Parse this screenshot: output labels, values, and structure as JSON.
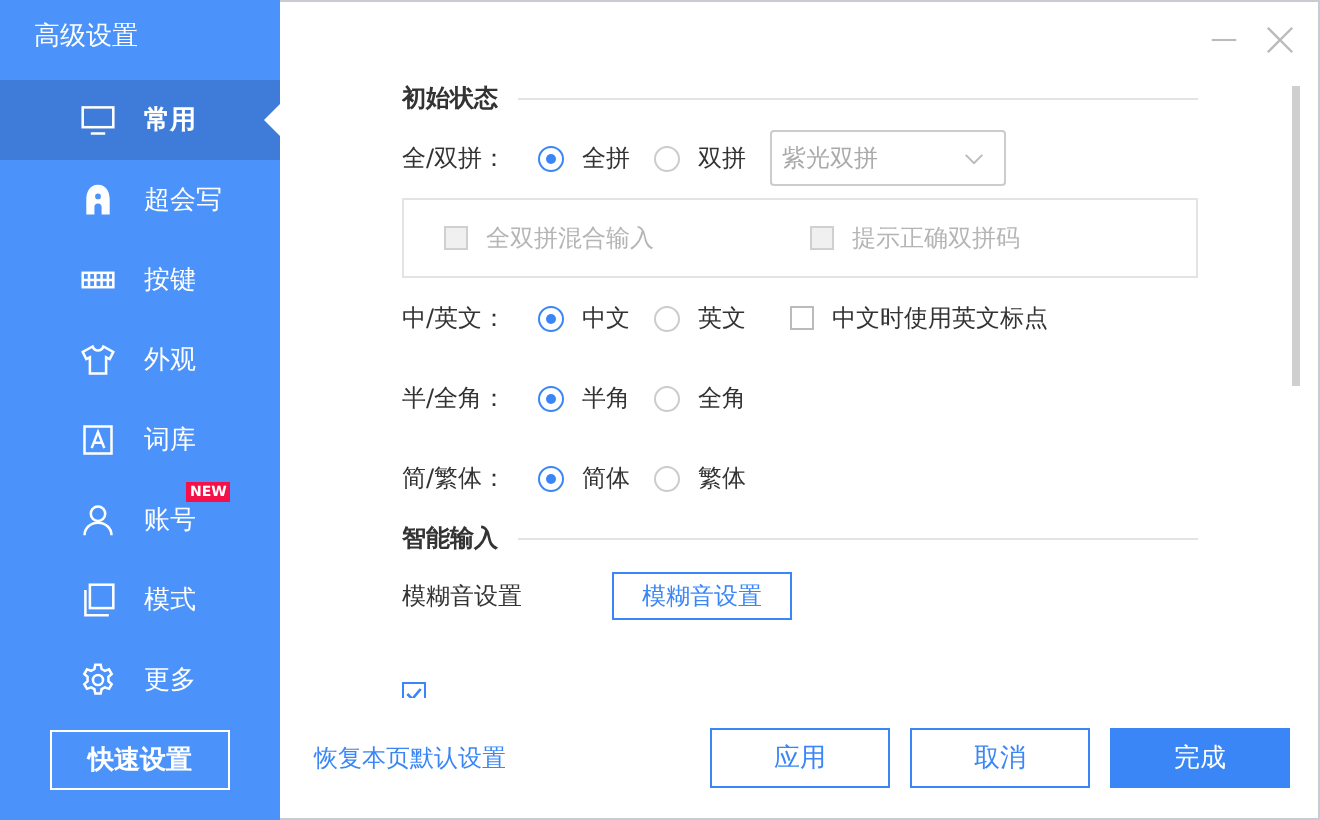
{
  "window": {
    "title": "高级设置"
  },
  "sidebar": {
    "items": [
      {
        "label": "常用",
        "selected": true
      },
      {
        "label": "超会写",
        "selected": false
      },
      {
        "label": "按键",
        "selected": false
      },
      {
        "label": "外观",
        "selected": false
      },
      {
        "label": "词库",
        "selected": false
      },
      {
        "label": "账号",
        "selected": false,
        "badge": "NEW"
      },
      {
        "label": "模式",
        "selected": false
      },
      {
        "label": "更多",
        "selected": false
      }
    ],
    "button": "快速设置"
  },
  "sections": [
    {
      "title": "初始状态",
      "rows": [
        {
          "kind": "radio",
          "label": "全/双拼：",
          "options": [
            {
              "label": "全拼",
              "selected": true
            },
            {
              "label": "双拼",
              "selected": false
            }
          ],
          "dropdown": {
            "value": "紫光双拼",
            "disabled": true
          }
        },
        {
          "kind": "group",
          "disabled": true,
          "items": [
            {
              "label": "全双拼混合输入",
              "checked": false
            },
            {
              "label": "提示正确双拼码",
              "checked": false
            }
          ]
        },
        {
          "kind": "radio",
          "label": "中/英文：",
          "options": [
            {
              "label": "中文",
              "selected": true
            },
            {
              "label": "英文",
              "selected": false
            }
          ],
          "checkbox": {
            "label": "中文时使用英文标点",
            "checked": false
          }
        },
        {
          "kind": "radio",
          "label": "半/全角：",
          "options": [
            {
              "label": "半角",
              "selected": true
            },
            {
              "label": "全角",
              "selected": false
            }
          ]
        },
        {
          "kind": "radio",
          "label": "简/繁体：",
          "options": [
            {
              "label": "简体",
              "selected": true
            },
            {
              "label": "繁体",
              "selected": false
            }
          ]
        }
      ]
    },
    {
      "title": "智能输入",
      "rows": [
        {
          "kind": "button",
          "label": "模糊音设置",
          "button": "模糊音设置"
        },
        {
          "kind": "check",
          "checked": true
        }
      ]
    }
  ],
  "footer": {
    "link": "恢复本页默认设置",
    "buttons": [
      {
        "label": "应用",
        "primary": false
      },
      {
        "label": "取消",
        "primary": false
      },
      {
        "label": "完成",
        "primary": true
      }
    ]
  }
}
